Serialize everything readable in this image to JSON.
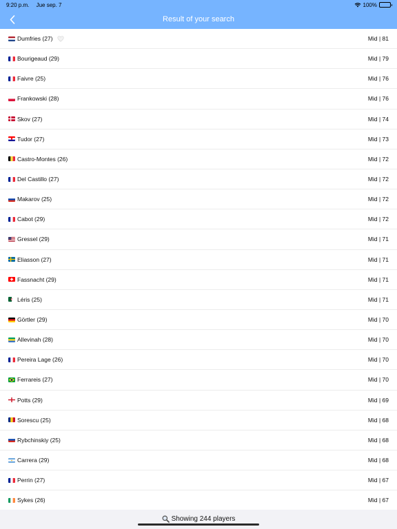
{
  "status": {
    "time": "9:20 p.m.",
    "date": "Jue sep. 7",
    "battery": "100%",
    "battery_level": 1.0
  },
  "header": {
    "title": "Result of your search"
  },
  "players": [
    {
      "name": "Dumfries (27)",
      "flag": "NL",
      "rating": "Mid | 81",
      "favorite": true
    },
    {
      "name": "Bourigeaud (29)",
      "flag": "FR",
      "rating": "Mid | 79"
    },
    {
      "name": "Faivre (25)",
      "flag": "FR",
      "rating": "Mid | 76"
    },
    {
      "name": "Frankowski (28)",
      "flag": "PL",
      "rating": "Mid | 76"
    },
    {
      "name": "Skov (27)",
      "flag": "DK",
      "rating": "Mid | 74"
    },
    {
      "name": "Tudor (27)",
      "flag": "HR",
      "rating": "Mid | 73"
    },
    {
      "name": "Castro-Montes (26)",
      "flag": "BE",
      "rating": "Mid | 72"
    },
    {
      "name": "Del Castillo (27)",
      "flag": "FR",
      "rating": "Mid | 72"
    },
    {
      "name": "Makarov (25)",
      "flag": "RU",
      "rating": "Mid | 72"
    },
    {
      "name": "Cabot (29)",
      "flag": "FR",
      "rating": "Mid | 72"
    },
    {
      "name": "Gressel (29)",
      "flag": "US",
      "rating": "Mid | 71"
    },
    {
      "name": "Eliasson (27)",
      "flag": "SE",
      "rating": "Mid | 71"
    },
    {
      "name": "Fassnacht (29)",
      "flag": "CH",
      "rating": "Mid | 71"
    },
    {
      "name": "Léris (25)",
      "flag": "DZ",
      "rating": "Mid | 71"
    },
    {
      "name": "Görtler (29)",
      "flag": "DE",
      "rating": "Mid | 70"
    },
    {
      "name": "Allevinah (28)",
      "flag": "GA",
      "rating": "Mid | 70"
    },
    {
      "name": "Pereira Lage (26)",
      "flag": "FR",
      "rating": "Mid | 70"
    },
    {
      "name": "Ferrareis (27)",
      "flag": "BR",
      "rating": "Mid | 70"
    },
    {
      "name": "Potts (29)",
      "flag": "EN",
      "rating": "Mid | 69"
    },
    {
      "name": "Sorescu (25)",
      "flag": "RO",
      "rating": "Mid | 68"
    },
    {
      "name": "Rybchinskiy (25)",
      "flag": "RU",
      "rating": "Mid | 68"
    },
    {
      "name": "Carrera (29)",
      "flag": "AR",
      "rating": "Mid | 68"
    },
    {
      "name": "Perrin (27)",
      "flag": "FR",
      "rating": "Mid | 67"
    },
    {
      "name": "Sykes (26)",
      "flag": "IE",
      "rating": "Mid | 67"
    }
  ],
  "footer": {
    "label": "Showing 244 players",
    "icon": "magnifier-icon"
  },
  "colors": {
    "nav_bg": "#76b4ff",
    "footer_bg": "#f2f2f6"
  }
}
